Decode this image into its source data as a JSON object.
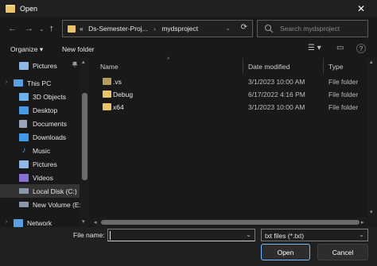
{
  "window": {
    "title": "Open",
    "close_glyph": "✕"
  },
  "nav": {
    "back_glyph": "←",
    "forward_glyph": "→",
    "recent_glyph": "⌄",
    "up_glyph": "↑",
    "breadcrumb": [
      "«",
      "Ds-Semester-Proj...",
      "mydsproject"
    ],
    "separator": "›",
    "dropdown_glyph": "⌄",
    "refresh_glyph": "⟳",
    "search_placeholder": "Search mydsproject"
  },
  "toolbar": {
    "organize_label": "Organize ▾",
    "new_folder_label": "New folder",
    "view_glyph": "☰ ▾",
    "pane_glyph": "▭",
    "help_glyph": "?"
  },
  "sidebar": {
    "items": [
      {
        "label": "Pictures",
        "icon": "pictures-icon",
        "color": "#8fb8e8",
        "pinned": true
      },
      {
        "label": "This PC",
        "icon": "pc-icon",
        "color": "#5aa0e0",
        "expander": "›"
      },
      {
        "label": "3D Objects",
        "icon": "cube-icon",
        "color": "#6fb0e8"
      },
      {
        "label": "Desktop",
        "icon": "desktop-icon",
        "color": "#4a9ae6"
      },
      {
        "label": "Documents",
        "icon": "documents-icon",
        "color": "#9aa6b8"
      },
      {
        "label": "Downloads",
        "icon": "downloads-icon",
        "color": "#3f9be8"
      },
      {
        "label": "Music",
        "icon": "music-icon",
        "color": "#5f9ce6"
      },
      {
        "label": "Pictures",
        "icon": "pictures-icon",
        "color": "#8fb8e8"
      },
      {
        "label": "Videos",
        "icon": "videos-icon",
        "color": "#8a6fd8"
      },
      {
        "label": "Local Disk (C:)",
        "icon": "drive-icon",
        "color": "#8a98aa",
        "selected": true
      },
      {
        "label": "New Volume (E:)",
        "icon": "drive-icon",
        "color": "#8a98aa"
      },
      {
        "label": "Network",
        "icon": "network-icon",
        "color": "#5aa0e0",
        "expander": "›"
      }
    ],
    "pin_glyph": "📌"
  },
  "filelist": {
    "columns": {
      "name": "Name",
      "date": "Date modified",
      "type": "Type"
    },
    "sort_glyph": "^",
    "rows": [
      {
        "name": ".vs",
        "date": "3/1/2023 10:00 AM",
        "type": "File folder",
        "color": "#b59b5a"
      },
      {
        "name": "Debug",
        "date": "6/17/2022 4:16 PM",
        "type": "File folder",
        "color": "#e9c46a"
      },
      {
        "name": "x64",
        "date": "3/1/2023 10:00 AM",
        "type": "File folder",
        "color": "#e9c46a"
      }
    ]
  },
  "bottom": {
    "filename_label": "File name:",
    "filename_value": "",
    "filter_value": "txt files (*.txt)",
    "open_label": "Open",
    "cancel_label": "Cancel"
  },
  "colors": {
    "accent_border": "#7ab7ff",
    "folder": "#e9c46a",
    "background": "#191919"
  }
}
